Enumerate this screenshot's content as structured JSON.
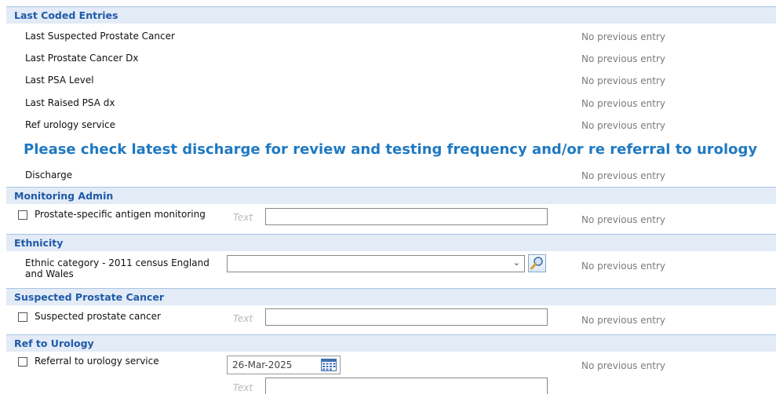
{
  "last_coded": {
    "header": "Last Coded Entries",
    "rows": [
      {
        "label": "Last Suspected Prostate Cancer",
        "prev": "No previous entry"
      },
      {
        "label": "Last Prostate Cancer Dx",
        "prev": "No previous entry"
      },
      {
        "label": "Last PSA Level",
        "prev": "No previous entry"
      },
      {
        "label": "Last Raised PSA dx",
        "prev": "No previous entry"
      },
      {
        "label": "Ref urology service",
        "prev": "No previous entry"
      }
    ],
    "banner": "Please check latest discharge for review and testing frequency and/or re referral to urology",
    "discharge": {
      "label": "Discharge",
      "prev": "No previous entry"
    }
  },
  "monitoring": {
    "header": "Monitoring Admin",
    "label": "Prostate-specific antigen monitoring",
    "placeholder": "Text",
    "value": "",
    "prev": "No previous entry"
  },
  "ethnicity": {
    "header": "Ethnicity",
    "label": "Ethnic category - 2011 census England and Wales",
    "selected": "",
    "prev": "No previous entry"
  },
  "suspected": {
    "header": "Suspected Prostate Cancer",
    "label": "Suspected prostate cancer",
    "placeholder": "Text",
    "value": "",
    "prev": "No previous entry"
  },
  "urology": {
    "header": "Ref to Urology",
    "label": "Referral to urology service",
    "date": "26-Mar-2025",
    "placeholder": "Text",
    "value": "",
    "prev": "No previous entry"
  },
  "colors": {
    "header_bg": "#e2ebf6",
    "header_text": "#1f5aa8",
    "banner": "#1f79c2",
    "muted": "#7b7b7b"
  },
  "icons": {
    "lookup": "magnifier-icon",
    "calendar": "calendar-icon",
    "dropdown": "chevron-down-icon"
  }
}
